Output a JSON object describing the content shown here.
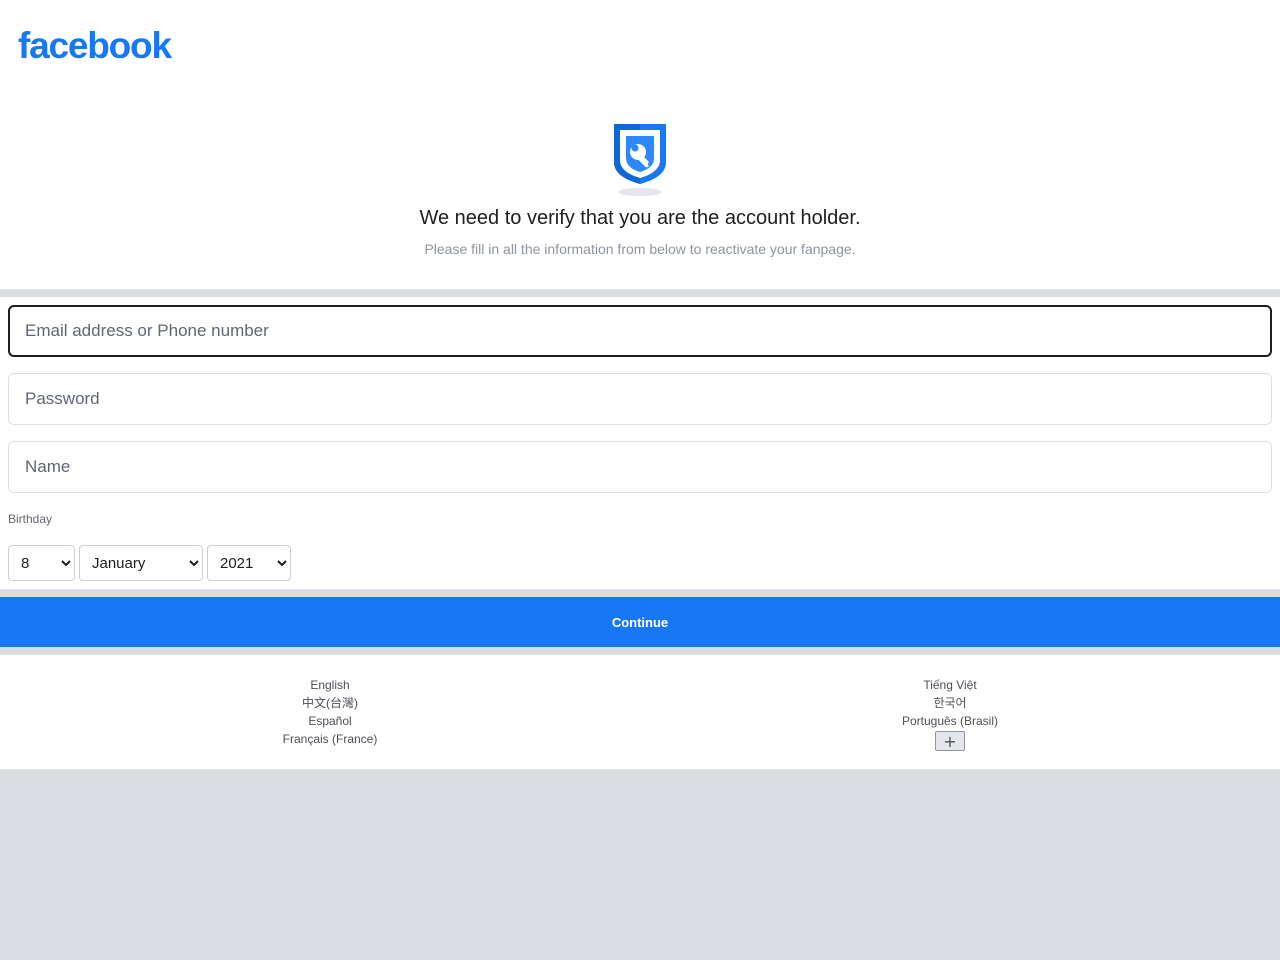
{
  "brand": {
    "logo_text": "facebook",
    "color": "#1877f2"
  },
  "hero": {
    "icon": "shield-wrench-icon",
    "title": "We need to verify that you are the account holder.",
    "subtitle": "Please fill in all the information from below to reactivate your fanpage."
  },
  "form": {
    "email_placeholder": "Email address or Phone number",
    "password_placeholder": "Password",
    "name_placeholder": "Name",
    "birthday_label": "Birthday",
    "day_value": "8",
    "month_value": "January",
    "year_value": "2021",
    "continue_label": "Continue"
  },
  "footer": {
    "languages_left": [
      "English",
      "中文(台灣)",
      "Español",
      "Français (France)"
    ],
    "languages_right": [
      "Tiếng Việt",
      "한국어",
      "Português (Brasil)"
    ],
    "more_label": "+"
  }
}
